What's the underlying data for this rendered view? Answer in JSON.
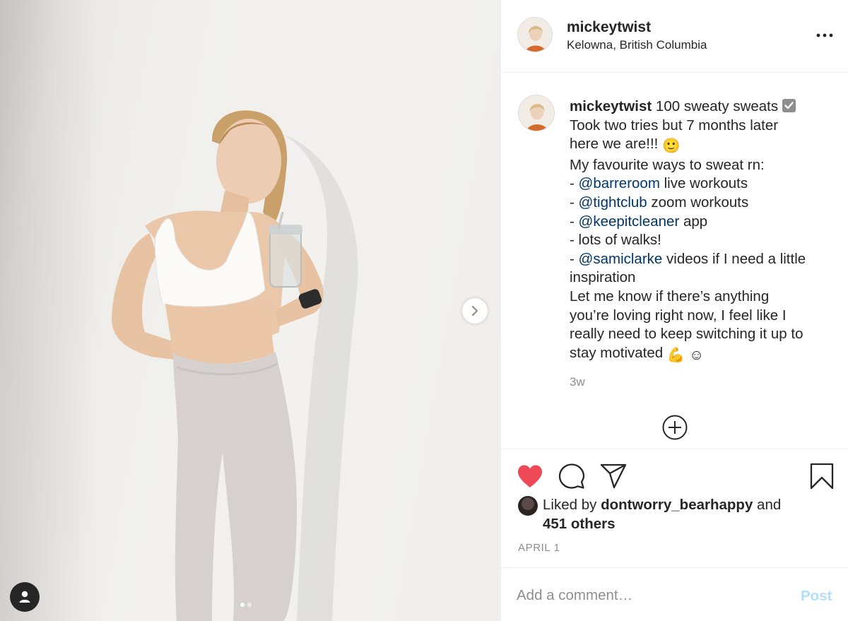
{
  "post": {
    "username": "mickeytwist",
    "location": "Kelowna, British Columbia",
    "caption": {
      "username": "mickeytwist",
      "first_text": " 100 sweaty sweats ",
      "line2": "Took two tries but 7 months later",
      "line3": "here we are!!! ",
      "line4": "My favourite ways to sweat rn:",
      "dash": "- ",
      "mention1": "@barreroom",
      "after1": " live workouts",
      "mention2": "@tightclub",
      "after2": " zoom workouts",
      "mention3": "@keepitcleaner",
      "after3": " app",
      "line_walks": "- lots of walks!",
      "mention4": "@samiclarke",
      "after4": " videos if I need a little",
      "line_inspo": "inspiration",
      "line_a": "Let me know if there’s anything",
      "line_b": "you’re loving right now, I feel like I",
      "line_c": "really need to keep switching it up to",
      "line_d": "stay motivated ",
      "emoji_smile": "🙂",
      "emoji_muscle": "💪",
      "emoji_relaxed": "☺"
    },
    "time_ago": "3w",
    "likes": {
      "prefix": "Liked by ",
      "liker": "dontworry_bearhappy",
      "middle": " and",
      "others": "451 others"
    },
    "date": "APRIL 1",
    "carousel": {
      "count": 2,
      "active_index": 0
    }
  },
  "comment": {
    "placeholder": "Add a comment…",
    "post_label": "Post"
  },
  "icons": {
    "more": "more-options-icon",
    "like": "heart-icon",
    "comment": "comment-icon",
    "share": "direct-share-icon",
    "save": "bookmark-icon",
    "load_more": "plus-circle-icon",
    "next": "chevron-right-icon",
    "user_tags": "user-icon"
  },
  "colors": {
    "liked_heart": "#ed4956",
    "mention": "#00376b",
    "muted": "#8e8e8e",
    "post_disabled": "#b2dffc"
  }
}
